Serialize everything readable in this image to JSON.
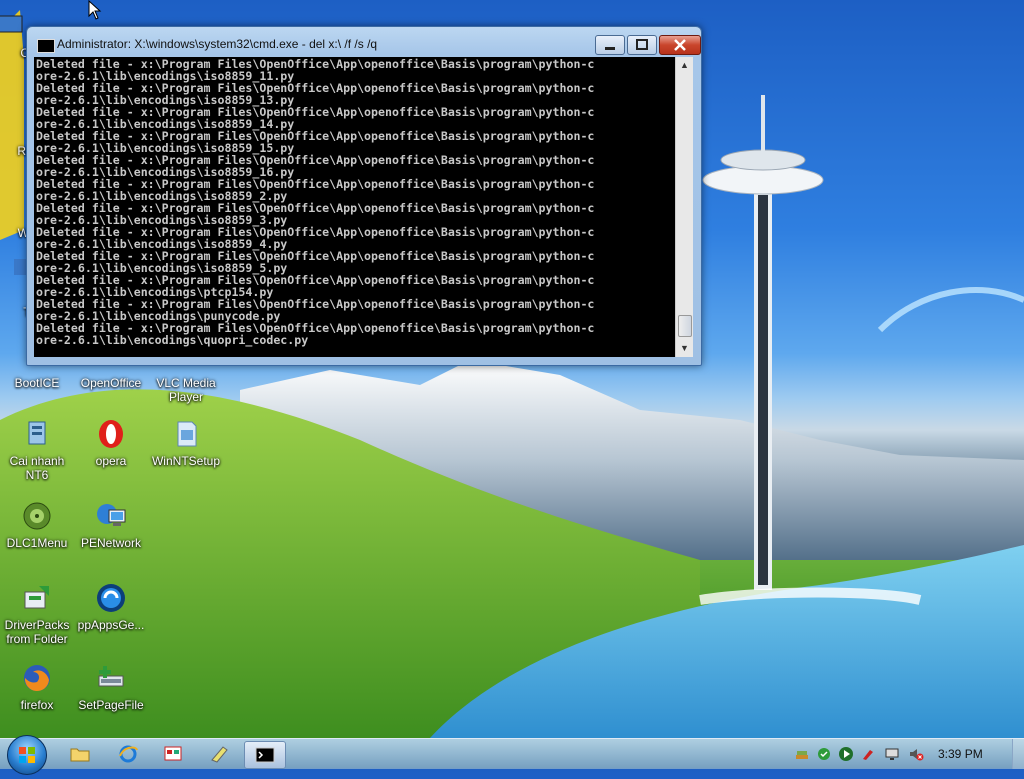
{
  "window": {
    "title": "Administrator: X:\\windows\\system32\\cmd.exe - del  x:\\ /f /s /q",
    "lines": [
      "Deleted file - x:\\Program Files\\OpenOffice\\App\\openoffice\\Basis\\program\\python-c",
      "ore-2.6.1\\lib\\encodings\\iso8859_11.py",
      "Deleted file - x:\\Program Files\\OpenOffice\\App\\openoffice\\Basis\\program\\python-c",
      "ore-2.6.1\\lib\\encodings\\iso8859_13.py",
      "Deleted file - x:\\Program Files\\OpenOffice\\App\\openoffice\\Basis\\program\\python-c",
      "ore-2.6.1\\lib\\encodings\\iso8859_14.py",
      "Deleted file - x:\\Program Files\\OpenOffice\\App\\openoffice\\Basis\\program\\python-c",
      "ore-2.6.1\\lib\\encodings\\iso8859_15.py",
      "Deleted file - x:\\Program Files\\OpenOffice\\App\\openoffice\\Basis\\program\\python-c",
      "ore-2.6.1\\lib\\encodings\\iso8859_16.py",
      "Deleted file - x:\\Program Files\\OpenOffice\\App\\openoffice\\Basis\\program\\python-c",
      "ore-2.6.1\\lib\\encodings\\iso8859_2.py",
      "Deleted file - x:\\Program Files\\OpenOffice\\App\\openoffice\\Basis\\program\\python-c",
      "ore-2.6.1\\lib\\encodings\\iso8859_3.py",
      "Deleted file - x:\\Program Files\\OpenOffice\\App\\openoffice\\Basis\\program\\python-c",
      "ore-2.6.1\\lib\\encodings\\iso8859_4.py",
      "Deleted file - x:\\Program Files\\OpenOffice\\App\\openoffice\\Basis\\program\\python-c",
      "ore-2.6.1\\lib\\encodings\\iso8859_5.py",
      "Deleted file - x:\\Program Files\\OpenOffice\\App\\openoffice\\Basis\\program\\python-c",
      "ore-2.6.1\\lib\\encodings\\ptcp154.py",
      "Deleted file - x:\\Program Files\\OpenOffice\\App\\openoffice\\Basis\\program\\python-c",
      "ore-2.6.1\\lib\\encodings\\punycode.py",
      "Deleted file - x:\\Program Files\\OpenOffice\\App\\openoffice\\Basis\\program\\python-c",
      "ore-2.6.1\\lib\\encodings\\quopri_codec.py"
    ]
  },
  "desktop": {
    "partial_labels": [
      "Co",
      "Rec",
      "Win",
      "A",
      "Tru"
    ],
    "icons": [
      {
        "label": "BootICE",
        "icon": "bootice-icon"
      },
      {
        "label": "OpenOffice",
        "icon": "openoffice-icon"
      },
      {
        "label": "VLC Media Player",
        "icon": "vlc-icon"
      },
      {
        "label": "Cai nhanh NT6",
        "icon": "installer-icon"
      },
      {
        "label": "opera",
        "icon": "opera-icon"
      },
      {
        "label": "WinNTSetup",
        "icon": "winntsetup-icon"
      },
      {
        "label": "DLC1Menu",
        "icon": "dlc-icon"
      },
      {
        "label": "PENetwork",
        "icon": "network-icon"
      },
      {
        "label": "DriverPacks from Folder",
        "icon": "driverpacks-icon"
      },
      {
        "label": "ppAppsGe...",
        "icon": "ppapps-icon"
      },
      {
        "label": "firefox",
        "icon": "firefox-icon"
      },
      {
        "label": "SetPageFile",
        "icon": "setpagefile-icon"
      }
    ]
  },
  "taskbar": {
    "clock": "3:39 PM"
  },
  "colors": {
    "console_bg": "#000000",
    "console_fg": "#c8c8c8",
    "close_red": "#c9452c"
  }
}
